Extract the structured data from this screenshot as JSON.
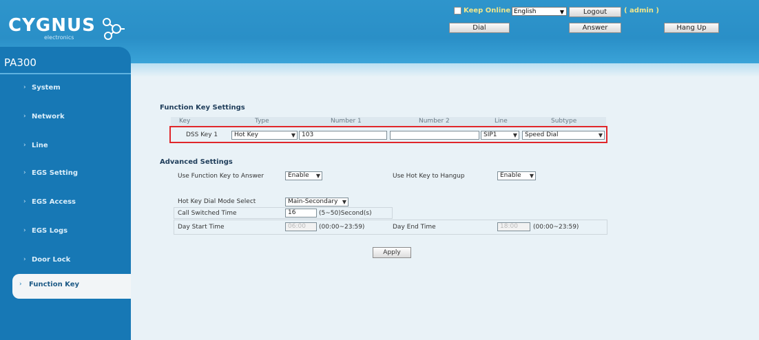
{
  "header": {
    "logo_text": "CYGNUS",
    "logo_sub": "electronics",
    "keep_online_label": "Keep Online",
    "language": "English",
    "logout_label": "Logout",
    "user_label": "( admin )",
    "dial_label": "Dial",
    "answer_label": "Answer",
    "hangup_label": "Hang Up"
  },
  "sidebar": {
    "title": "PA300",
    "items": [
      {
        "label": "System"
      },
      {
        "label": "Network"
      },
      {
        "label": "Line"
      },
      {
        "label": "EGS Setting"
      },
      {
        "label": "EGS Access"
      },
      {
        "label": "EGS Logs"
      },
      {
        "label": "Door Lock"
      },
      {
        "label": "Function Key"
      }
    ]
  },
  "function_keys": {
    "title": "Function Key Settings",
    "headers": [
      "Key",
      "Type",
      "Number 1",
      "Number 2",
      "Line",
      "Subtype"
    ],
    "row": {
      "key": "DSS Key 1",
      "type": "Hot Key",
      "number1": "103",
      "number2": "",
      "line": "SIP1",
      "subtype": "Speed Dial"
    }
  },
  "advanced": {
    "title": "Advanced Settings",
    "use_fk_answer_label": "Use Function Key to Answer",
    "use_fk_answer_value": "Enable",
    "use_hotkey_hangup_label": "Use Hot Key to Hangup",
    "use_hotkey_hangup_value": "Enable",
    "hotkey_dial_mode_label": "Hot Key Dial Mode Select",
    "hotkey_dial_mode_value": "Main-Secondary",
    "call_switched_label": "Call Switched Time",
    "call_switched_value": "16",
    "call_switched_hint": "(5~50)Second(s)",
    "day_start_label": "Day Start Time",
    "day_start_value": "06:00",
    "day_start_hint": "(00:00~23:59)",
    "day_end_label": "Day End Time",
    "day_end_value": "18:00",
    "day_end_hint": "(00:00~23:59)"
  },
  "apply_label": "Apply",
  "colors": {
    "header_blue": "#2a8fc7",
    "sidebar_blue": "#1778b5",
    "highlight_red": "#e0262a",
    "background": "#e9f2f7"
  }
}
